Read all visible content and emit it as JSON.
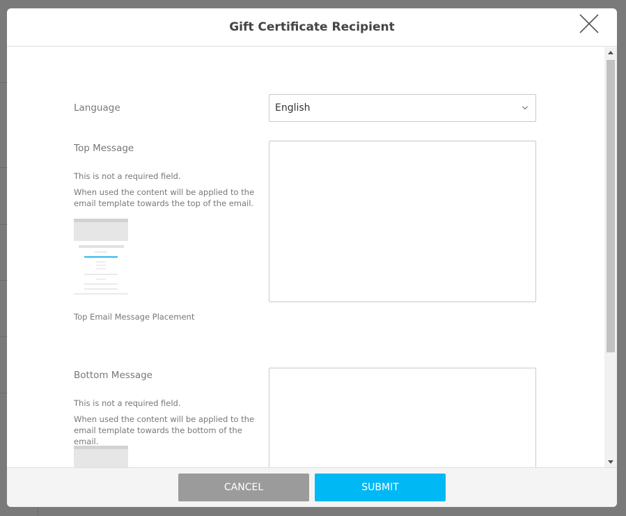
{
  "modal": {
    "title": "Gift Certificate Recipient"
  },
  "language": {
    "label": "Language",
    "selected": "English"
  },
  "top_message": {
    "label": "Top Message",
    "help_required": "This is not a required field.",
    "help_usage": "When used the content will be applied to the email template towards the top of the email.",
    "caption": "Top Email Message Placement",
    "value": ""
  },
  "bottom_message": {
    "label": "Bottom Message",
    "help_required": "This is not a required field.",
    "help_usage": "When used the content will be applied to the email template towards the bottom of the email.",
    "value": ""
  },
  "footer": {
    "cancel_label": "CANCEL",
    "submit_label": "SUBMIT"
  },
  "colors": {
    "accent": "#00b8f4",
    "cancel": "#9b9b9b",
    "overlay": "#7a7a7a"
  },
  "icons": {
    "close": "close-icon",
    "chevron": "chevron-down-icon",
    "scroll_up": "scroll-up-arrow-icon",
    "scroll_down": "scroll-down-arrow-icon"
  }
}
